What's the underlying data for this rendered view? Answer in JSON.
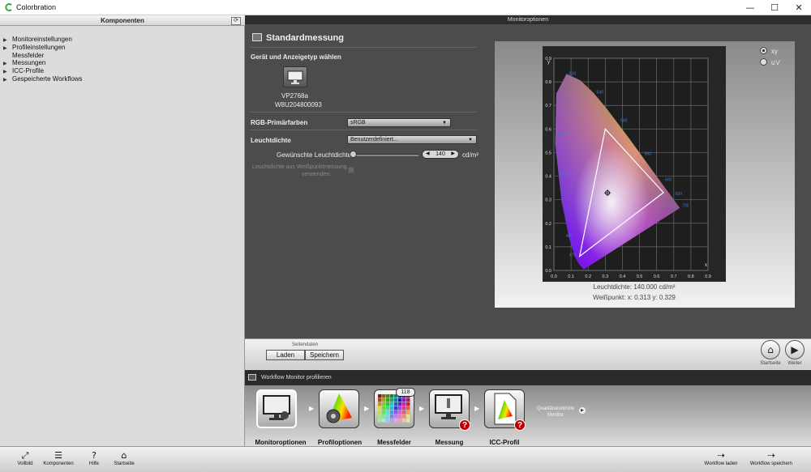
{
  "window": {
    "title": "Colorbration",
    "minimize": "—",
    "maximize": "☐",
    "close": "✕"
  },
  "left": {
    "header": "Komponenten",
    "refresh": "⟳",
    "items": [
      {
        "label": "Monitoreinstellungen",
        "expandable": true
      },
      {
        "label": "Profileinstellungen",
        "expandable": true
      },
      {
        "label": "Messfelder",
        "expandable": false
      },
      {
        "label": "Messungen",
        "expandable": true
      },
      {
        "label": "ICC-Profile",
        "expandable": true
      },
      {
        "label": "Gespeicherte Workflows",
        "expandable": true
      }
    ]
  },
  "right": {
    "header": "Monitoroptionen",
    "section_title": "Standardmessung",
    "device_heading": "Gerät und Anzeigetyp wählen",
    "device_model": "VP2768a",
    "device_serial": "W8U204800093",
    "rgb_label": "RGB-Primärfarben",
    "rgb_value": "sRGB",
    "lum_label": "Leuchtdichte",
    "lum_value": "Benutzerdefiniert...",
    "desired_lum_label": "Gewünschte Leuchtdichte:",
    "desired_lum_value": "140",
    "desired_lum_unit": "cd/m²",
    "from_white_label_1": "Leuchtdichte aus Weißpunktmessung",
    "from_white_label_2": "verwenden:"
  },
  "chart_data": {
    "type": "scatter",
    "title": "",
    "x_axis_label": "x",
    "y_axis_label": "y",
    "x_ticks": [
      "0.0",
      "0.1",
      "0.2",
      "0.3",
      "0.4",
      "0.5",
      "0.6",
      "0.7",
      "0.8",
      "0.9"
    ],
    "y_ticks": [
      "0.0",
      "0.1",
      "0.2",
      "0.3",
      "0.4",
      "0.5",
      "0.6",
      "0.7",
      "0.8",
      "0.9"
    ],
    "xlim": [
      0,
      0.9
    ],
    "ylim": [
      0,
      0.9
    ],
    "grid": true,
    "wavelength_labels": [
      {
        "label": "520",
        "x": 0.07,
        "y": 0.83
      },
      {
        "label": "540",
        "x": 0.23,
        "y": 0.75
      },
      {
        "label": "560",
        "x": 0.37,
        "y": 0.63
      },
      {
        "label": "580",
        "x": 0.51,
        "y": 0.49
      },
      {
        "label": "600",
        "x": 0.63,
        "y": 0.38
      },
      {
        "label": "620",
        "x": 0.69,
        "y": 0.32
      },
      {
        "label": "700",
        "x": 0.73,
        "y": 0.27
      },
      {
        "label": "500",
        "x": 0.0,
        "y": 0.57
      },
      {
        "label": "490",
        "x": 0.02,
        "y": 0.4
      },
      {
        "label": "480",
        "x": 0.05,
        "y": 0.14
      },
      {
        "label": "470",
        "x": 0.07,
        "y": 0.06
      }
    ],
    "gamut_triangle": [
      [
        0.64,
        0.33
      ],
      [
        0.3,
        0.6
      ],
      [
        0.15,
        0.06
      ]
    ],
    "white_point": [
      0.313,
      0.329
    ],
    "view_options": [
      "xy",
      "u'v'"
    ],
    "selected_view": "xy",
    "caption_lum": "Leuchtdichte: 140.000 cd/m²",
    "caption_wp": "Weißpunkt: x: 0.313  y: 0.329"
  },
  "pagebar": {
    "group_label": "Seitendaten",
    "load": "Laden",
    "save": "Speichern",
    "home_label": "Startseite",
    "next_label": "Weiter",
    "home_glyph": "⌂",
    "next_glyph": "▶"
  },
  "workflow": {
    "header": "Workflow Monitor profilieren",
    "steps": [
      {
        "label": "Monitoroptionen"
      },
      {
        "label": "Profiloptionen"
      },
      {
        "label": "Messfelder",
        "badge": "118"
      },
      {
        "label": "Messung",
        "warn": "?"
      },
      {
        "label": "ICC-Profil",
        "warn": "?"
      }
    ],
    "quality_1": "Qualitätskontrolle",
    "quality_2": "Monitor"
  },
  "bottombar": {
    "items": [
      {
        "label": "Vollbild",
        "glyph": "⤢"
      },
      {
        "label": "Komponenten",
        "glyph": "☰"
      },
      {
        "label": "Hilfe",
        "glyph": "?"
      },
      {
        "label": "Startseite",
        "glyph": "⌂"
      }
    ],
    "wf_load": "Workflow laden",
    "wf_save": "Workflow speichern",
    "wf_load_glyph": "⇢",
    "wf_save_glyph": "⇢"
  }
}
